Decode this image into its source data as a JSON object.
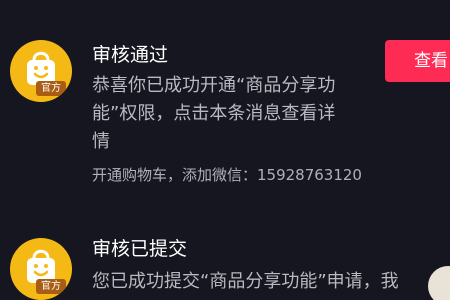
{
  "messages": [
    {
      "title": "审核通过",
      "body": "恭喜你已成功开通“商品分享功能”权限，点击本条消息查看详情",
      "note": "开通购物车，添加微信：15928763120",
      "badge": "官方",
      "button_label": "查看"
    },
    {
      "title": "审核已提交",
      "body": "您已成功提交“商品分享功能”申请，我",
      "badge": "官方"
    }
  ],
  "colors": {
    "background": "#15161f",
    "avatar": "#f5b915",
    "badge": "#a85d12",
    "button": "#fe2c55"
  },
  "icons": {
    "avatar": "shopping-bag-smile-icon"
  }
}
